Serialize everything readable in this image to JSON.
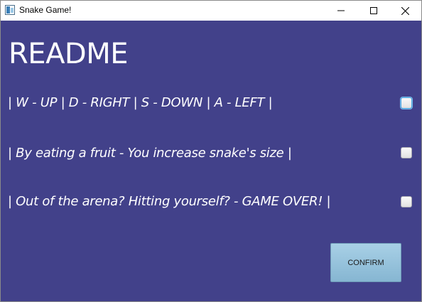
{
  "window": {
    "title": "Snake Game!",
    "controls": {
      "minimize": "minimize-icon",
      "maximize": "maximize-icon",
      "close": "close-icon"
    }
  },
  "content": {
    "heading": "README",
    "rules": [
      {
        "text": "| W - UP | D - RIGHT | S - DOWN | A - LEFT |",
        "checked": false,
        "focused": true
      },
      {
        "text": "| By eating a fruit - You increase snake's size |",
        "checked": false,
        "focused": false
      },
      {
        "text": "| Out of the arena? Hitting yourself? - GAME OVER! |",
        "checked": false,
        "focused": false
      }
    ],
    "confirm_label": "CONFIRM"
  },
  "colors": {
    "background": "#42418a",
    "text": "#ffffff",
    "button": "#9cc6df"
  }
}
